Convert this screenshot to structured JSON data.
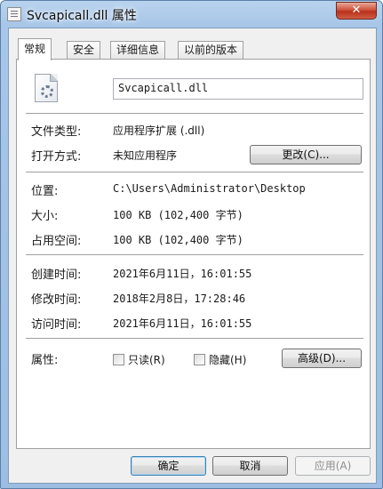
{
  "window": {
    "title": "Svcapicall.dll 属性",
    "close_glyph": "✕"
  },
  "tabs": [
    "常规",
    "安全",
    "详细信息",
    "以前的版本"
  ],
  "general": {
    "file_name": "Svcapicall.dll",
    "rows": [
      {
        "label": "文件类型:",
        "value": "应用程序扩展 (.dll)"
      },
      {
        "label": "打开方式:",
        "value": "未知应用程序"
      },
      {
        "label": "位置:",
        "value": "C:\\Users\\Administrator\\Desktop"
      },
      {
        "label": "大小:",
        "value": "100 KB (102,400 字节)"
      },
      {
        "label": "占用空间:",
        "value": "100 KB (102,400 字节)"
      },
      {
        "label": "创建时间:",
        "value": "2021年6月11日，16:01:55"
      },
      {
        "label": "修改时间:",
        "value": "2018年2月8日，17:28:46"
      },
      {
        "label": "访问时间:",
        "value": "2021年6月11日，16:01:55"
      },
      {
        "label": "属性:"
      }
    ],
    "change_button": "更改(C)...",
    "readonly_label": "只读(R)",
    "hidden_label": "隐藏(H)",
    "advanced_button": "高级(D)..."
  },
  "footer": {
    "ok": "确定",
    "cancel": "取消",
    "apply": "应用(A)"
  },
  "icons": {
    "window": "file-icon",
    "file": "dll-gear-file-icon"
  }
}
